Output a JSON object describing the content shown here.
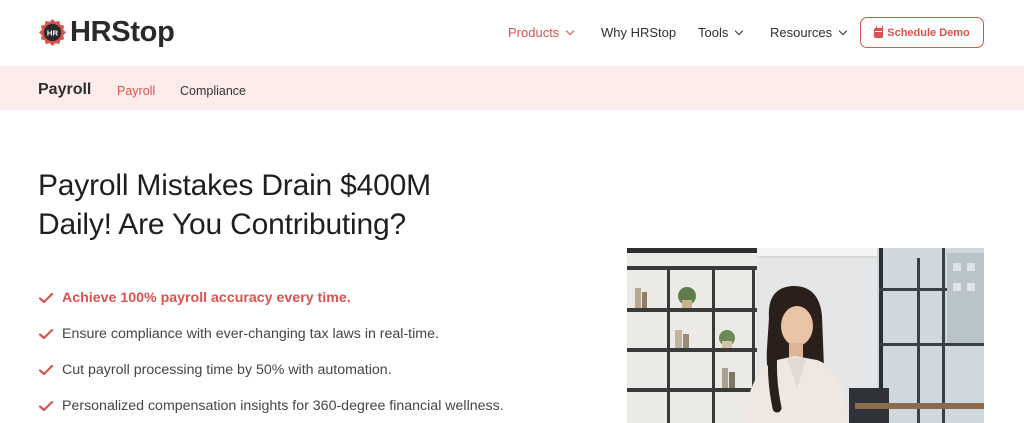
{
  "brand": {
    "logo_text": "HRStop",
    "badge_text": "HR",
    "accent_color": "#d9534f"
  },
  "nav": {
    "items": [
      {
        "label": "Products",
        "has_dropdown": true,
        "active": true
      },
      {
        "label": "Why HRStop",
        "has_dropdown": false,
        "active": false
      },
      {
        "label": "Tools",
        "has_dropdown": true,
        "active": false
      },
      {
        "label": "Resources",
        "has_dropdown": true,
        "active": false
      }
    ],
    "cta_label": "Schedule Demo",
    "cta_icon": "calendar-icon"
  },
  "subnav": {
    "title": "Payroll",
    "links": [
      {
        "label": "Payroll",
        "active": true
      },
      {
        "label": "Compliance",
        "active": false
      }
    ],
    "background": "#fdecea"
  },
  "hero": {
    "headline_line1": "Payroll Mistakes Drain $400M",
    "headline_line2": "Daily! Are You Contributing?",
    "benefits": [
      {
        "text": "Achieve 100% payroll accuracy every time.",
        "highlight": true
      },
      {
        "text": "Ensure compliance with ever-changing tax laws in real-time.",
        "highlight": false
      },
      {
        "text": "Cut payroll processing time by 50% with automation.",
        "highlight": false
      },
      {
        "text": "Personalized compensation insights for 360-degree financial wellness.",
        "highlight": false
      }
    ],
    "benefit_icon": "checkmark-icon"
  }
}
